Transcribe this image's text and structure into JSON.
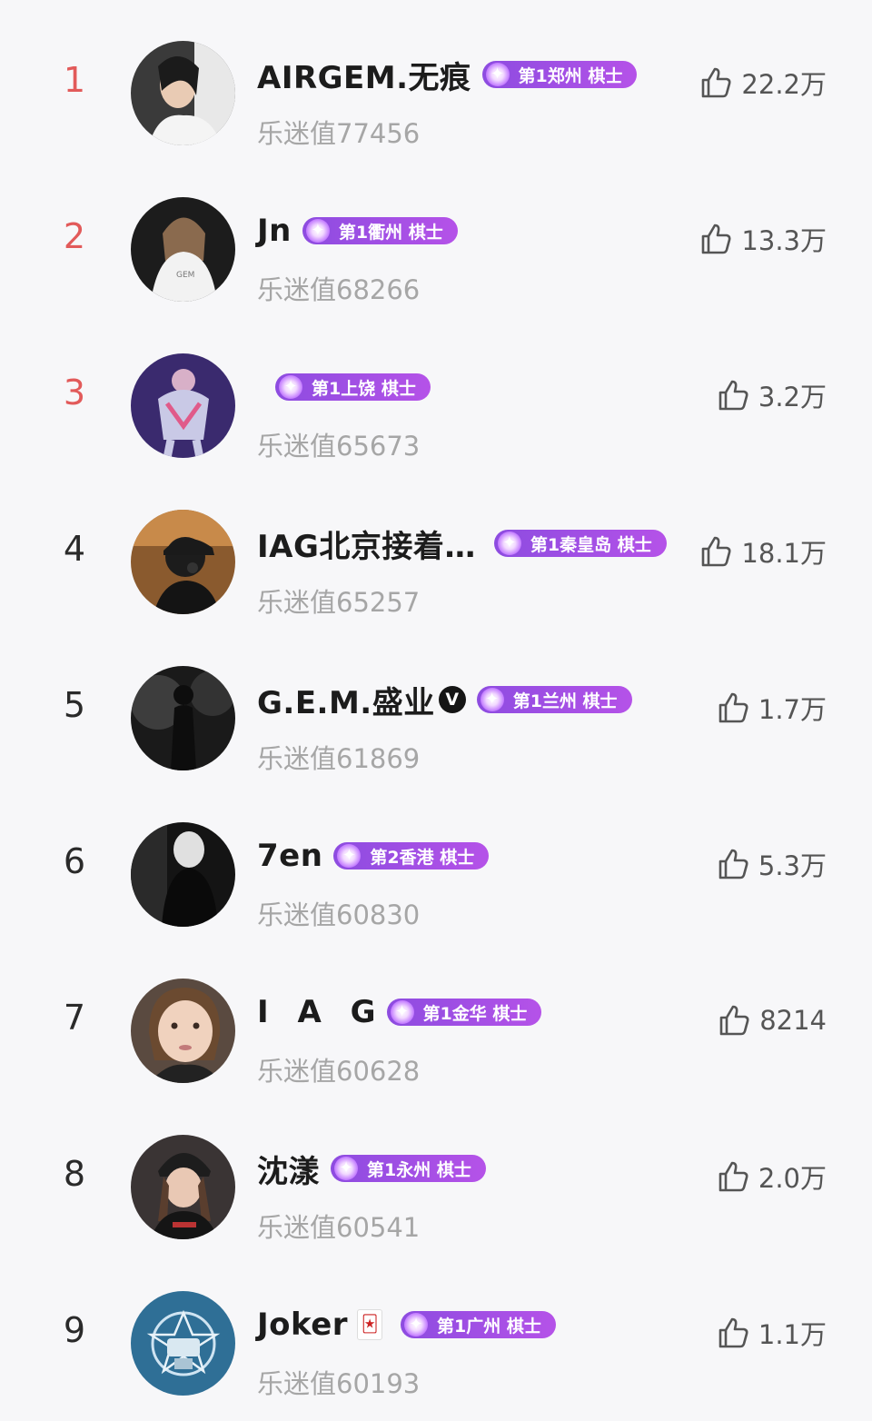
{
  "colors": {
    "rank_top": "#e25a5a",
    "rank_default": "#2a2a2a",
    "badge": "#9a4ee4",
    "score_text": "#a6a6a6"
  },
  "rows": [
    {
      "rank": "1",
      "name": "AIRGEM.无痕",
      "badge": "第1郑州 棋士",
      "score": "乐迷值77456",
      "likes": "22.2万",
      "avatar_icon": "avatar-woman-white-top"
    },
    {
      "rank": "2",
      "name": "Jn",
      "badge": "第1衢州 棋士",
      "score": "乐迷值68266",
      "likes": "13.3万",
      "avatar_icon": "avatar-woman-back-white-shirt"
    },
    {
      "rank": "3",
      "name": "",
      "badge": "第1上饶 棋士",
      "score": "乐迷值65673",
      "likes": "3.2万",
      "avatar_icon": "avatar-stage-costume"
    },
    {
      "rank": "4",
      "name": "IAG北京接着…",
      "badge": "第1秦皇岛 棋士",
      "score": "乐迷值65257",
      "likes": "18.1万",
      "avatar_icon": "avatar-headphones-cap"
    },
    {
      "rank": "5",
      "name": "G.E.M.盛业",
      "verified": "V",
      "badge": "第1兰州 棋士",
      "score": "乐迷值61869",
      "likes": "1.7万",
      "avatar_icon": "avatar-concert-silhouette"
    },
    {
      "rank": "6",
      "name": "7en",
      "badge": "第2香港 棋士",
      "score": "乐迷值60830",
      "likes": "5.3万",
      "avatar_icon": "avatar-masked-figure"
    },
    {
      "rank": "7",
      "name": "I A G",
      "badge": "第1金华 棋士",
      "score": "乐迷值60628",
      "likes": "8214",
      "avatar_icon": "avatar-child-face"
    },
    {
      "rank": "8",
      "name": "沈漾",
      "badge": "第1永州 棋士",
      "score": "乐迷值60541",
      "likes": "2.0万",
      "avatar_icon": "avatar-beanie-girl"
    },
    {
      "rank": "9",
      "name": "Joker",
      "emoji": "🃏",
      "badge": "第1广州 棋士",
      "score": "乐迷值60193",
      "likes": "1.1万",
      "avatar_icon": "avatar-gem-logo"
    }
  ]
}
